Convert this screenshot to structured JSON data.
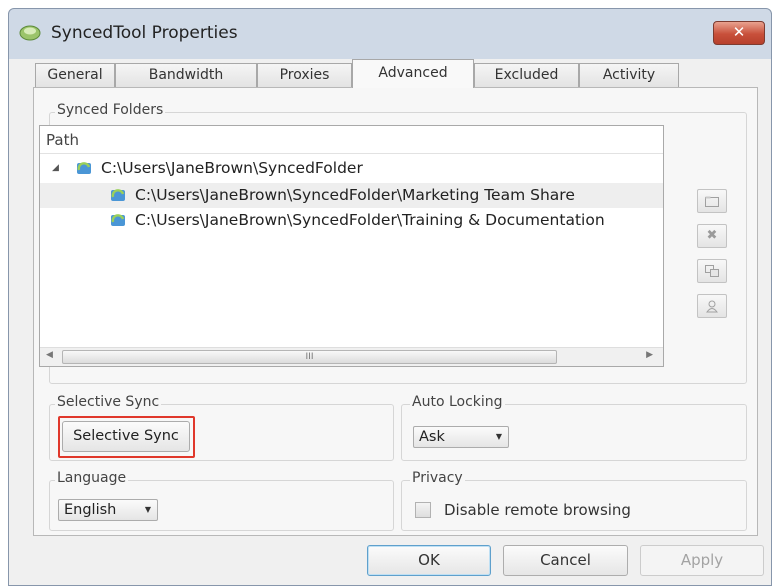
{
  "window": {
    "title": "SyncedTool Properties",
    "close_label": "✕"
  },
  "tabs": [
    {
      "label": "General",
      "active": false
    },
    {
      "label": "Bandwidth",
      "active": false
    },
    {
      "label": "Proxies",
      "active": false
    },
    {
      "label": "Advanced",
      "active": true
    },
    {
      "label": "Excluded",
      "active": false
    },
    {
      "label": "Activity",
      "active": false
    }
  ],
  "synced_folders": {
    "group_label": "Synced Folders",
    "column_header": "Path",
    "rows": [
      {
        "path": "C:\\Users\\JaneBrown\\SyncedFolder"
      },
      {
        "path": "C:\\Users\\JaneBrown\\SyncedFolder\\Marketing Team Share"
      },
      {
        "path": "C:\\Users\\JaneBrown\\SyncedFolder\\Training & Documentation"
      }
    ],
    "scroll_grip": "III",
    "side_buttons": [
      {
        "name": "folder-icon"
      },
      {
        "name": "remove-icon",
        "glyph": "✖"
      },
      {
        "name": "copy-icon"
      },
      {
        "name": "user-icon"
      }
    ]
  },
  "selective_sync": {
    "group_label": "Selective Sync",
    "button_label": "Selective Sync"
  },
  "auto_locking": {
    "group_label": "Auto Locking",
    "selected": "Ask"
  },
  "language": {
    "group_label": "Language",
    "selected": "English"
  },
  "privacy": {
    "group_label": "Privacy",
    "checkbox_label": "Disable remote browsing",
    "checked": false
  },
  "footer": {
    "ok_label": "OK",
    "cancel_label": "Cancel",
    "apply_label": "Apply"
  },
  "colors": {
    "highlight": "#e0382b",
    "close_button": "#c8503b"
  }
}
